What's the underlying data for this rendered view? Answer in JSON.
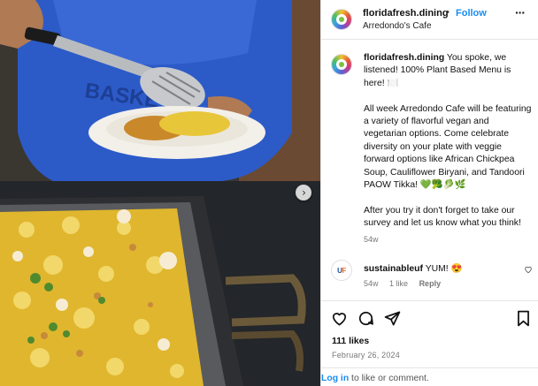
{
  "post": {
    "account": "floridafresh.dining",
    "follow_label": "Follow",
    "location": "Arredondo's Cafe",
    "caption_paragraphs": [
      "You spoke, we listened! 100% Plant Based Menu is here! 🍽️",
      "All week Arredondo Cafe will be featuring a variety of flavorful vegan and vegetarian options. Come celebrate diversity on your plate with veggie forward options like African Chickpea Soup, Cauliflower Biryani, and Tandoori PAOW Tikka! 💚🥦🥬🌿",
      "After you try it don't forget to take our survey and let us know what you think!"
    ],
    "caption_time": "54w",
    "likes": "111 likes",
    "date": "February 26, 2024"
  },
  "comment": {
    "user": "sustainableuf",
    "text": "YUM! 😍",
    "time": "54w",
    "likes": "1 like",
    "reply": "Reply",
    "avatar_text": "UF"
  },
  "footer": {
    "login": "Log in",
    "rest": " to like or comment."
  },
  "icons": {
    "like": "heart-icon",
    "comment": "comment-icon",
    "share": "send-icon",
    "save": "bookmark-icon",
    "more": "more-icon",
    "next": "chevron-right-icon"
  },
  "colors": {
    "link_blue": "#1a8cf0",
    "muted": "#777777"
  }
}
